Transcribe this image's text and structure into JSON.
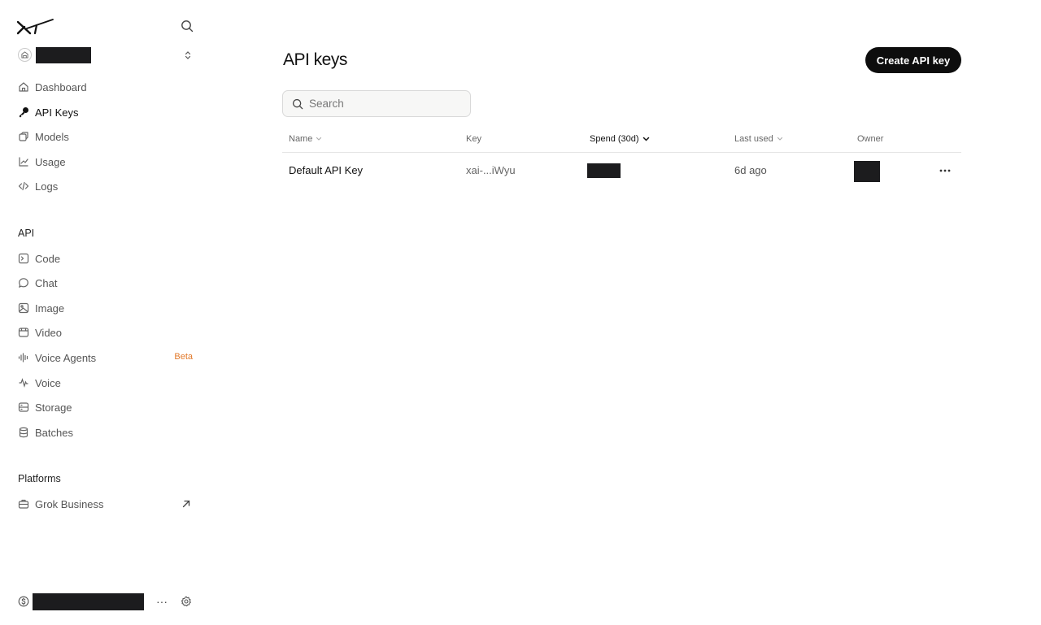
{
  "sidebar": {
    "nav": [
      {
        "label": "Dashboard",
        "icon": "home-icon"
      },
      {
        "label": "API Keys",
        "icon": "key-icon",
        "active": true
      },
      {
        "label": "Models",
        "icon": "cube-icon"
      },
      {
        "label": "Usage",
        "icon": "chart-icon"
      },
      {
        "label": "Logs",
        "icon": "code-icon"
      }
    ],
    "api_section_title": "API",
    "api_items": [
      {
        "label": "Code"
      },
      {
        "label": "Chat"
      },
      {
        "label": "Image"
      },
      {
        "label": "Video"
      },
      {
        "label": "Voice Agents",
        "badge": "Beta"
      },
      {
        "label": "Voice"
      },
      {
        "label": "Storage"
      },
      {
        "label": "Batches"
      }
    ],
    "platforms_section_title": "Platforms",
    "platform_items": [
      {
        "label": "Grok Business"
      }
    ],
    "footer_more": "···"
  },
  "main": {
    "title": "API keys",
    "create_button": "Create API key",
    "search_placeholder": "Search",
    "table": {
      "columns": {
        "name": "Name",
        "key": "Key",
        "spend": "Spend (30d)",
        "last_used": "Last used",
        "owner": "Owner"
      },
      "rows": [
        {
          "name": "Default API Key",
          "key": "xai-...iWyu",
          "last_used": "6d ago"
        }
      ]
    }
  },
  "colors": {
    "accent_badge": "#e2792a",
    "button_bg": "#0d0d0d",
    "redaction": "#1c1c1e"
  }
}
